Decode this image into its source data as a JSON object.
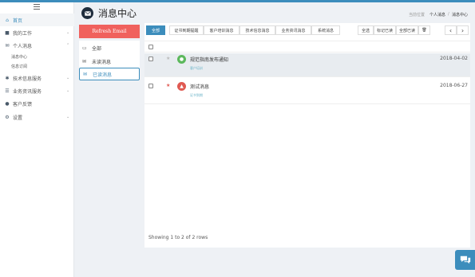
{
  "sidebar": {
    "items": [
      {
        "label": "首页",
        "icon": "home-icon",
        "glyph": "⌂",
        "chev": ""
      },
      {
        "label": "我的工作",
        "icon": "briefcase-icon",
        "glyph": "■",
        "chev": "⌄"
      },
      {
        "label": "个人消息",
        "icon": "envelope-icon",
        "glyph": "✉",
        "chev": "⌃"
      },
      {
        "label": "技术信息服务",
        "icon": "cogs-icon",
        "glyph": "✱",
        "chev": "⌄"
      },
      {
        "label": "业务资讯服务",
        "icon": "list-icon",
        "glyph": "☰",
        "chev": "⌄"
      },
      {
        "label": "客户反馈",
        "icon": "comments-icon",
        "glyph": "●",
        "chev": ""
      },
      {
        "label": "设置",
        "icon": "gear-icon",
        "glyph": "⚙",
        "chev": "⌄"
      }
    ],
    "sub_items": [
      "消息中心",
      "信息订阅"
    ]
  },
  "header": {
    "title": "消息中心",
    "breadcrumb_location": "当前位置",
    "breadcrumb_1": "个人消息",
    "breadcrumb_sep": "/",
    "breadcrumb_2": "消息中心"
  },
  "left_panel": {
    "refresh_label": "Refresh Email",
    "menu": [
      {
        "label": "全部",
        "icon": "inbox-icon",
        "glyph": "▭"
      },
      {
        "label": "未读消息",
        "icon": "envelope-icon",
        "glyph": "✉"
      },
      {
        "label": "已读消息",
        "icon": "envelope-open-icon",
        "glyph": "✉"
      }
    ]
  },
  "toolbar": {
    "tabs": [
      "全部",
      "证书到期提醒",
      "客户培训消息",
      "技术信息消息",
      "业务资讯消息",
      "系统消息"
    ],
    "select_all": "全选",
    "mark_read": "标记已读",
    "all_read": "全部已读",
    "delete_glyph": "🗑",
    "prev_glyph": "‹",
    "next_glyph": "›"
  },
  "messages": [
    {
      "title": "规范指南发布通知",
      "tag": "客户培训",
      "date": "2018-04-02",
      "icon_color": "#5cb85c",
      "icon_glyph": "●"
    },
    {
      "title": "测试消息",
      "tag": "证书到期",
      "date": "2018-06-27",
      "icon_color": "#e05a52",
      "icon_glyph": "▲"
    }
  ],
  "footer": {
    "text": "Showing 1 to 2 of 2 rows"
  },
  "colors": {
    "accent": "#3c8dbc",
    "refresh": "#f0615d"
  }
}
